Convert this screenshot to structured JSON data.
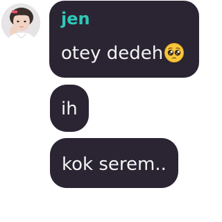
{
  "conversation": {
    "sender": {
      "name": "jen",
      "name_color": "#2fc9b7"
    },
    "messages": [
      {
        "text": "otey dedeh",
        "emoji": "pleading-face-icon"
      },
      {
        "text": "ih"
      },
      {
        "text": "kok serem.."
      }
    ],
    "bubble_color": "#2a2433"
  }
}
